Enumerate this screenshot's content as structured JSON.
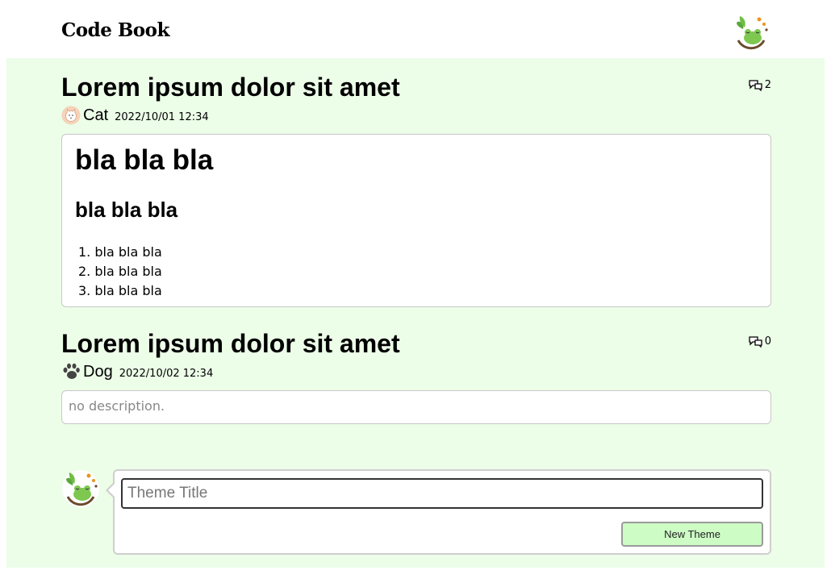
{
  "app": {
    "title": "Code Book"
  },
  "themes": [
    {
      "title": "Lorem ipsum dolor sit amet",
      "comment_count": "2",
      "author": "Cat",
      "date": "2022/10/01 12:34",
      "body": {
        "h1": "bla bla bla",
        "h2": "bla bla bla",
        "list": [
          "bla bla bla",
          "bla bla bla",
          "bla bla bla"
        ]
      }
    },
    {
      "title": "Lorem ipsum dolor sit amet",
      "comment_count": "0",
      "author": "Dog",
      "date": "2022/10/02 12:34",
      "description": "no description."
    }
  ],
  "composer": {
    "title_placeholder": "Theme Title",
    "submit_label": "New Theme"
  },
  "colors": {
    "background": "#ecfde8",
    "button": "#cdfcc5"
  },
  "icons": {
    "comments": "comment-bubbles-icon",
    "cat": "cat-avatar-icon",
    "dog": "paw-icon",
    "user": "frog-avatar-icon"
  }
}
